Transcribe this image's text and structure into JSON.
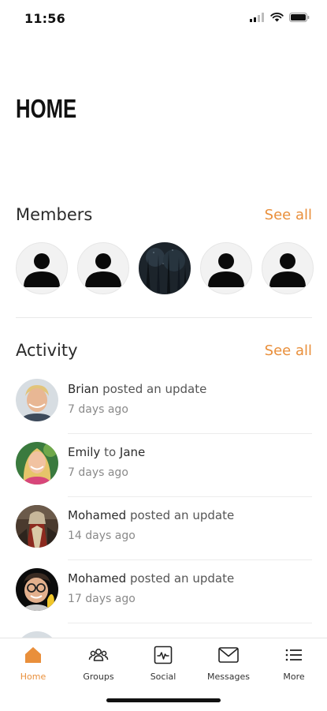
{
  "status_bar": {
    "time": "11:56"
  },
  "page": {
    "title": "HOME"
  },
  "members": {
    "title": "Members",
    "see_all": "See all",
    "avatars": [
      {
        "type": "placeholder",
        "icon": "person-icon"
      },
      {
        "type": "placeholder",
        "icon": "person-icon"
      },
      {
        "type": "photo",
        "icon": "forest-photo"
      },
      {
        "type": "placeholder",
        "icon": "person-icon"
      },
      {
        "type": "placeholder",
        "icon": "person-icon"
      }
    ]
  },
  "activity": {
    "title": "Activity",
    "see_all": "See all",
    "items": [
      {
        "actor": "Brian",
        "action": " posted an update",
        "time": "7 days ago"
      },
      {
        "actor": "Emily",
        "action": " to ",
        "target": "Jane",
        "time": "7 days ago"
      },
      {
        "actor": "Mohamed",
        "action": " posted an update",
        "time": "14 days ago"
      },
      {
        "actor": "Mohamed",
        "action": " posted an update",
        "time": "17 days ago"
      }
    ]
  },
  "tabs": [
    {
      "label": "Home",
      "icon": "home-icon",
      "active": true
    },
    {
      "label": "Groups",
      "icon": "groups-icon",
      "active": false
    },
    {
      "label": "Social",
      "icon": "social-icon",
      "active": false
    },
    {
      "label": "Messages",
      "icon": "messages-icon",
      "active": false
    },
    {
      "label": "More",
      "icon": "menu-icon",
      "active": false
    }
  ],
  "colors": {
    "accent": "#e98f3b",
    "text": "#2b2b2b",
    "muted": "#8a8a8a"
  }
}
